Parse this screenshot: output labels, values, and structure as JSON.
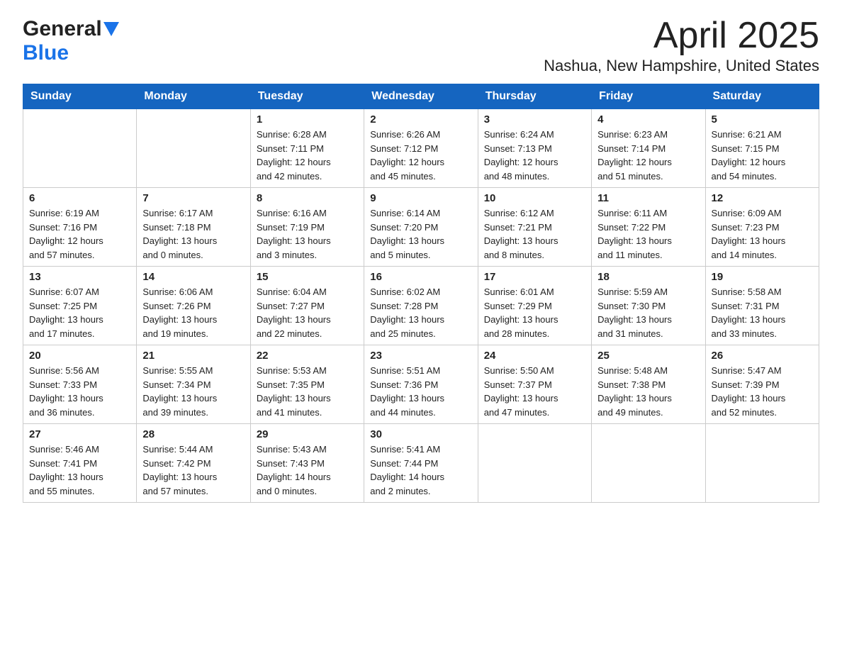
{
  "header": {
    "logo_general": "General",
    "logo_blue": "Blue",
    "month_title": "April 2025",
    "location": "Nashua, New Hampshire, United States"
  },
  "weekdays": [
    "Sunday",
    "Monday",
    "Tuesday",
    "Wednesday",
    "Thursday",
    "Friday",
    "Saturday"
  ],
  "weeks": [
    [
      {
        "day": "",
        "sunrise": "",
        "sunset": "",
        "daylight": ""
      },
      {
        "day": "",
        "sunrise": "",
        "sunset": "",
        "daylight": ""
      },
      {
        "day": "1",
        "sunrise": "Sunrise: 6:28 AM",
        "sunset": "Sunset: 7:11 PM",
        "daylight": "Daylight: 12 hours and 42 minutes."
      },
      {
        "day": "2",
        "sunrise": "Sunrise: 6:26 AM",
        "sunset": "Sunset: 7:12 PM",
        "daylight": "Daylight: 12 hours and 45 minutes."
      },
      {
        "day": "3",
        "sunrise": "Sunrise: 6:24 AM",
        "sunset": "Sunset: 7:13 PM",
        "daylight": "Daylight: 12 hours and 48 minutes."
      },
      {
        "day": "4",
        "sunrise": "Sunrise: 6:23 AM",
        "sunset": "Sunset: 7:14 PM",
        "daylight": "Daylight: 12 hours and 51 minutes."
      },
      {
        "day": "5",
        "sunrise": "Sunrise: 6:21 AM",
        "sunset": "Sunset: 7:15 PM",
        "daylight": "Daylight: 12 hours and 54 minutes."
      }
    ],
    [
      {
        "day": "6",
        "sunrise": "Sunrise: 6:19 AM",
        "sunset": "Sunset: 7:16 PM",
        "daylight": "Daylight: 12 hours and 57 minutes."
      },
      {
        "day": "7",
        "sunrise": "Sunrise: 6:17 AM",
        "sunset": "Sunset: 7:18 PM",
        "daylight": "Daylight: 13 hours and 0 minutes."
      },
      {
        "day": "8",
        "sunrise": "Sunrise: 6:16 AM",
        "sunset": "Sunset: 7:19 PM",
        "daylight": "Daylight: 13 hours and 3 minutes."
      },
      {
        "day": "9",
        "sunrise": "Sunrise: 6:14 AM",
        "sunset": "Sunset: 7:20 PM",
        "daylight": "Daylight: 13 hours and 5 minutes."
      },
      {
        "day": "10",
        "sunrise": "Sunrise: 6:12 AM",
        "sunset": "Sunset: 7:21 PM",
        "daylight": "Daylight: 13 hours and 8 minutes."
      },
      {
        "day": "11",
        "sunrise": "Sunrise: 6:11 AM",
        "sunset": "Sunset: 7:22 PM",
        "daylight": "Daylight: 13 hours and 11 minutes."
      },
      {
        "day": "12",
        "sunrise": "Sunrise: 6:09 AM",
        "sunset": "Sunset: 7:23 PM",
        "daylight": "Daylight: 13 hours and 14 minutes."
      }
    ],
    [
      {
        "day": "13",
        "sunrise": "Sunrise: 6:07 AM",
        "sunset": "Sunset: 7:25 PM",
        "daylight": "Daylight: 13 hours and 17 minutes."
      },
      {
        "day": "14",
        "sunrise": "Sunrise: 6:06 AM",
        "sunset": "Sunset: 7:26 PM",
        "daylight": "Daylight: 13 hours and 19 minutes."
      },
      {
        "day": "15",
        "sunrise": "Sunrise: 6:04 AM",
        "sunset": "Sunset: 7:27 PM",
        "daylight": "Daylight: 13 hours and 22 minutes."
      },
      {
        "day": "16",
        "sunrise": "Sunrise: 6:02 AM",
        "sunset": "Sunset: 7:28 PM",
        "daylight": "Daylight: 13 hours and 25 minutes."
      },
      {
        "day": "17",
        "sunrise": "Sunrise: 6:01 AM",
        "sunset": "Sunset: 7:29 PM",
        "daylight": "Daylight: 13 hours and 28 minutes."
      },
      {
        "day": "18",
        "sunrise": "Sunrise: 5:59 AM",
        "sunset": "Sunset: 7:30 PM",
        "daylight": "Daylight: 13 hours and 31 minutes."
      },
      {
        "day": "19",
        "sunrise": "Sunrise: 5:58 AM",
        "sunset": "Sunset: 7:31 PM",
        "daylight": "Daylight: 13 hours and 33 minutes."
      }
    ],
    [
      {
        "day": "20",
        "sunrise": "Sunrise: 5:56 AM",
        "sunset": "Sunset: 7:33 PM",
        "daylight": "Daylight: 13 hours and 36 minutes."
      },
      {
        "day": "21",
        "sunrise": "Sunrise: 5:55 AM",
        "sunset": "Sunset: 7:34 PM",
        "daylight": "Daylight: 13 hours and 39 minutes."
      },
      {
        "day": "22",
        "sunrise": "Sunrise: 5:53 AM",
        "sunset": "Sunset: 7:35 PM",
        "daylight": "Daylight: 13 hours and 41 minutes."
      },
      {
        "day": "23",
        "sunrise": "Sunrise: 5:51 AM",
        "sunset": "Sunset: 7:36 PM",
        "daylight": "Daylight: 13 hours and 44 minutes."
      },
      {
        "day": "24",
        "sunrise": "Sunrise: 5:50 AM",
        "sunset": "Sunset: 7:37 PM",
        "daylight": "Daylight: 13 hours and 47 minutes."
      },
      {
        "day": "25",
        "sunrise": "Sunrise: 5:48 AM",
        "sunset": "Sunset: 7:38 PM",
        "daylight": "Daylight: 13 hours and 49 minutes."
      },
      {
        "day": "26",
        "sunrise": "Sunrise: 5:47 AM",
        "sunset": "Sunset: 7:39 PM",
        "daylight": "Daylight: 13 hours and 52 minutes."
      }
    ],
    [
      {
        "day": "27",
        "sunrise": "Sunrise: 5:46 AM",
        "sunset": "Sunset: 7:41 PM",
        "daylight": "Daylight: 13 hours and 55 minutes."
      },
      {
        "day": "28",
        "sunrise": "Sunrise: 5:44 AM",
        "sunset": "Sunset: 7:42 PM",
        "daylight": "Daylight: 13 hours and 57 minutes."
      },
      {
        "day": "29",
        "sunrise": "Sunrise: 5:43 AM",
        "sunset": "Sunset: 7:43 PM",
        "daylight": "Daylight: 14 hours and 0 minutes."
      },
      {
        "day": "30",
        "sunrise": "Sunrise: 5:41 AM",
        "sunset": "Sunset: 7:44 PM",
        "daylight": "Daylight: 14 hours and 2 minutes."
      },
      {
        "day": "",
        "sunrise": "",
        "sunset": "",
        "daylight": ""
      },
      {
        "day": "",
        "sunrise": "",
        "sunset": "",
        "daylight": ""
      },
      {
        "day": "",
        "sunrise": "",
        "sunset": "",
        "daylight": ""
      }
    ]
  ]
}
